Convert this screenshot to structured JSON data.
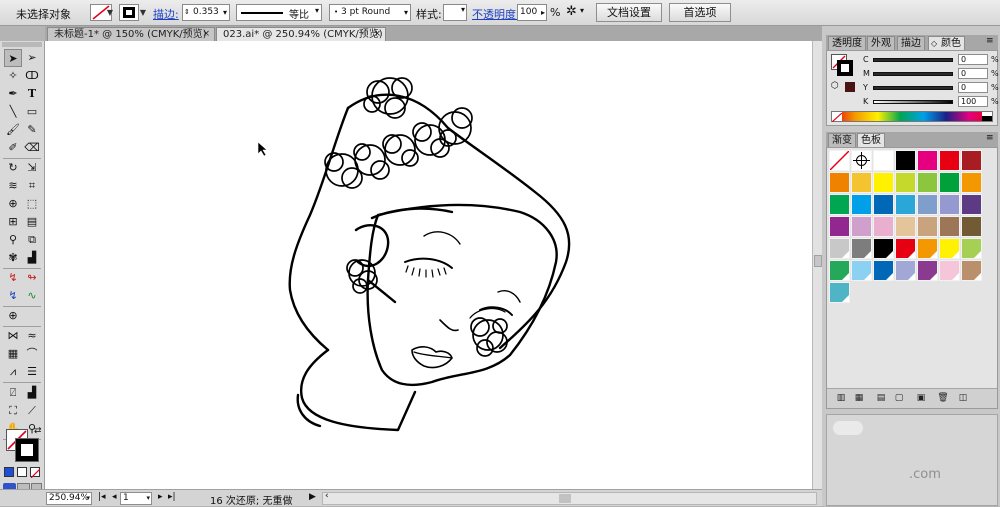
{
  "control_bar": {
    "selection_status": "未选择对象",
    "stroke_label": "描边:",
    "stroke_value": "0.353",
    "stroke_profile": "等比",
    "brush": "3 pt Round",
    "style_label": "样式:",
    "opacity_label": "不透明度:",
    "opacity_value": "100",
    "opacity_unit": "%",
    "doc_setup_button": "文档设置",
    "prefs_button": "首选项"
  },
  "tabs": [
    {
      "label": "未标题-1* @ 150% (CMYK/预览)",
      "close": "×"
    },
    {
      "label": "023.ai* @ 250.94% (CMYK/预览)",
      "close": "×"
    }
  ],
  "panels": {
    "top_tabs": [
      "透明度",
      "外观",
      "描边",
      "颜色"
    ],
    "cmyk": [
      {
        "letter": "C",
        "value": "0"
      },
      {
        "letter": "M",
        "value": "0"
      },
      {
        "letter": "Y",
        "value": "0"
      },
      {
        "letter": "K",
        "value": "100"
      }
    ],
    "percent": "%",
    "bottom_tabs": [
      "渐变",
      "色板"
    ],
    "swatches": [
      "none",
      "registration",
      "#ffffff",
      "#000000",
      "#e5007f",
      "#e60012",
      "#a71d23",
      "#ef8300",
      "#f4c430",
      "#fff100",
      "#c5d92d",
      "#8cc63f",
      "#00a13a",
      "#f39800",
      "#00a651",
      "#00a0e9",
      "#0068b7",
      "#2aa6d9",
      "#7f9ecb",
      "#949ad0",
      "#5d3a84",
      "#92278f",
      "#d09fcb",
      "#eaafce",
      "#e4c49a",
      "#c9a27e",
      "#9c7656",
      "#725b34",
      "#c8c8c8",
      "#7d7d7d",
      "#000000",
      "#e60012",
      "#f39800",
      "#fff100",
      "#a6d055",
      "#26a85a",
      "#8cd1f1",
      "#0068b7",
      "#a2a8d5",
      "#8a3b8f",
      "#f5c6da",
      "#ba8f6b",
      "#4fb4c6"
    ]
  },
  "status": {
    "zoom": "250.94%",
    "page": "1",
    "undo_text": "16 次还原; 无重做"
  },
  "watermark": ".com"
}
